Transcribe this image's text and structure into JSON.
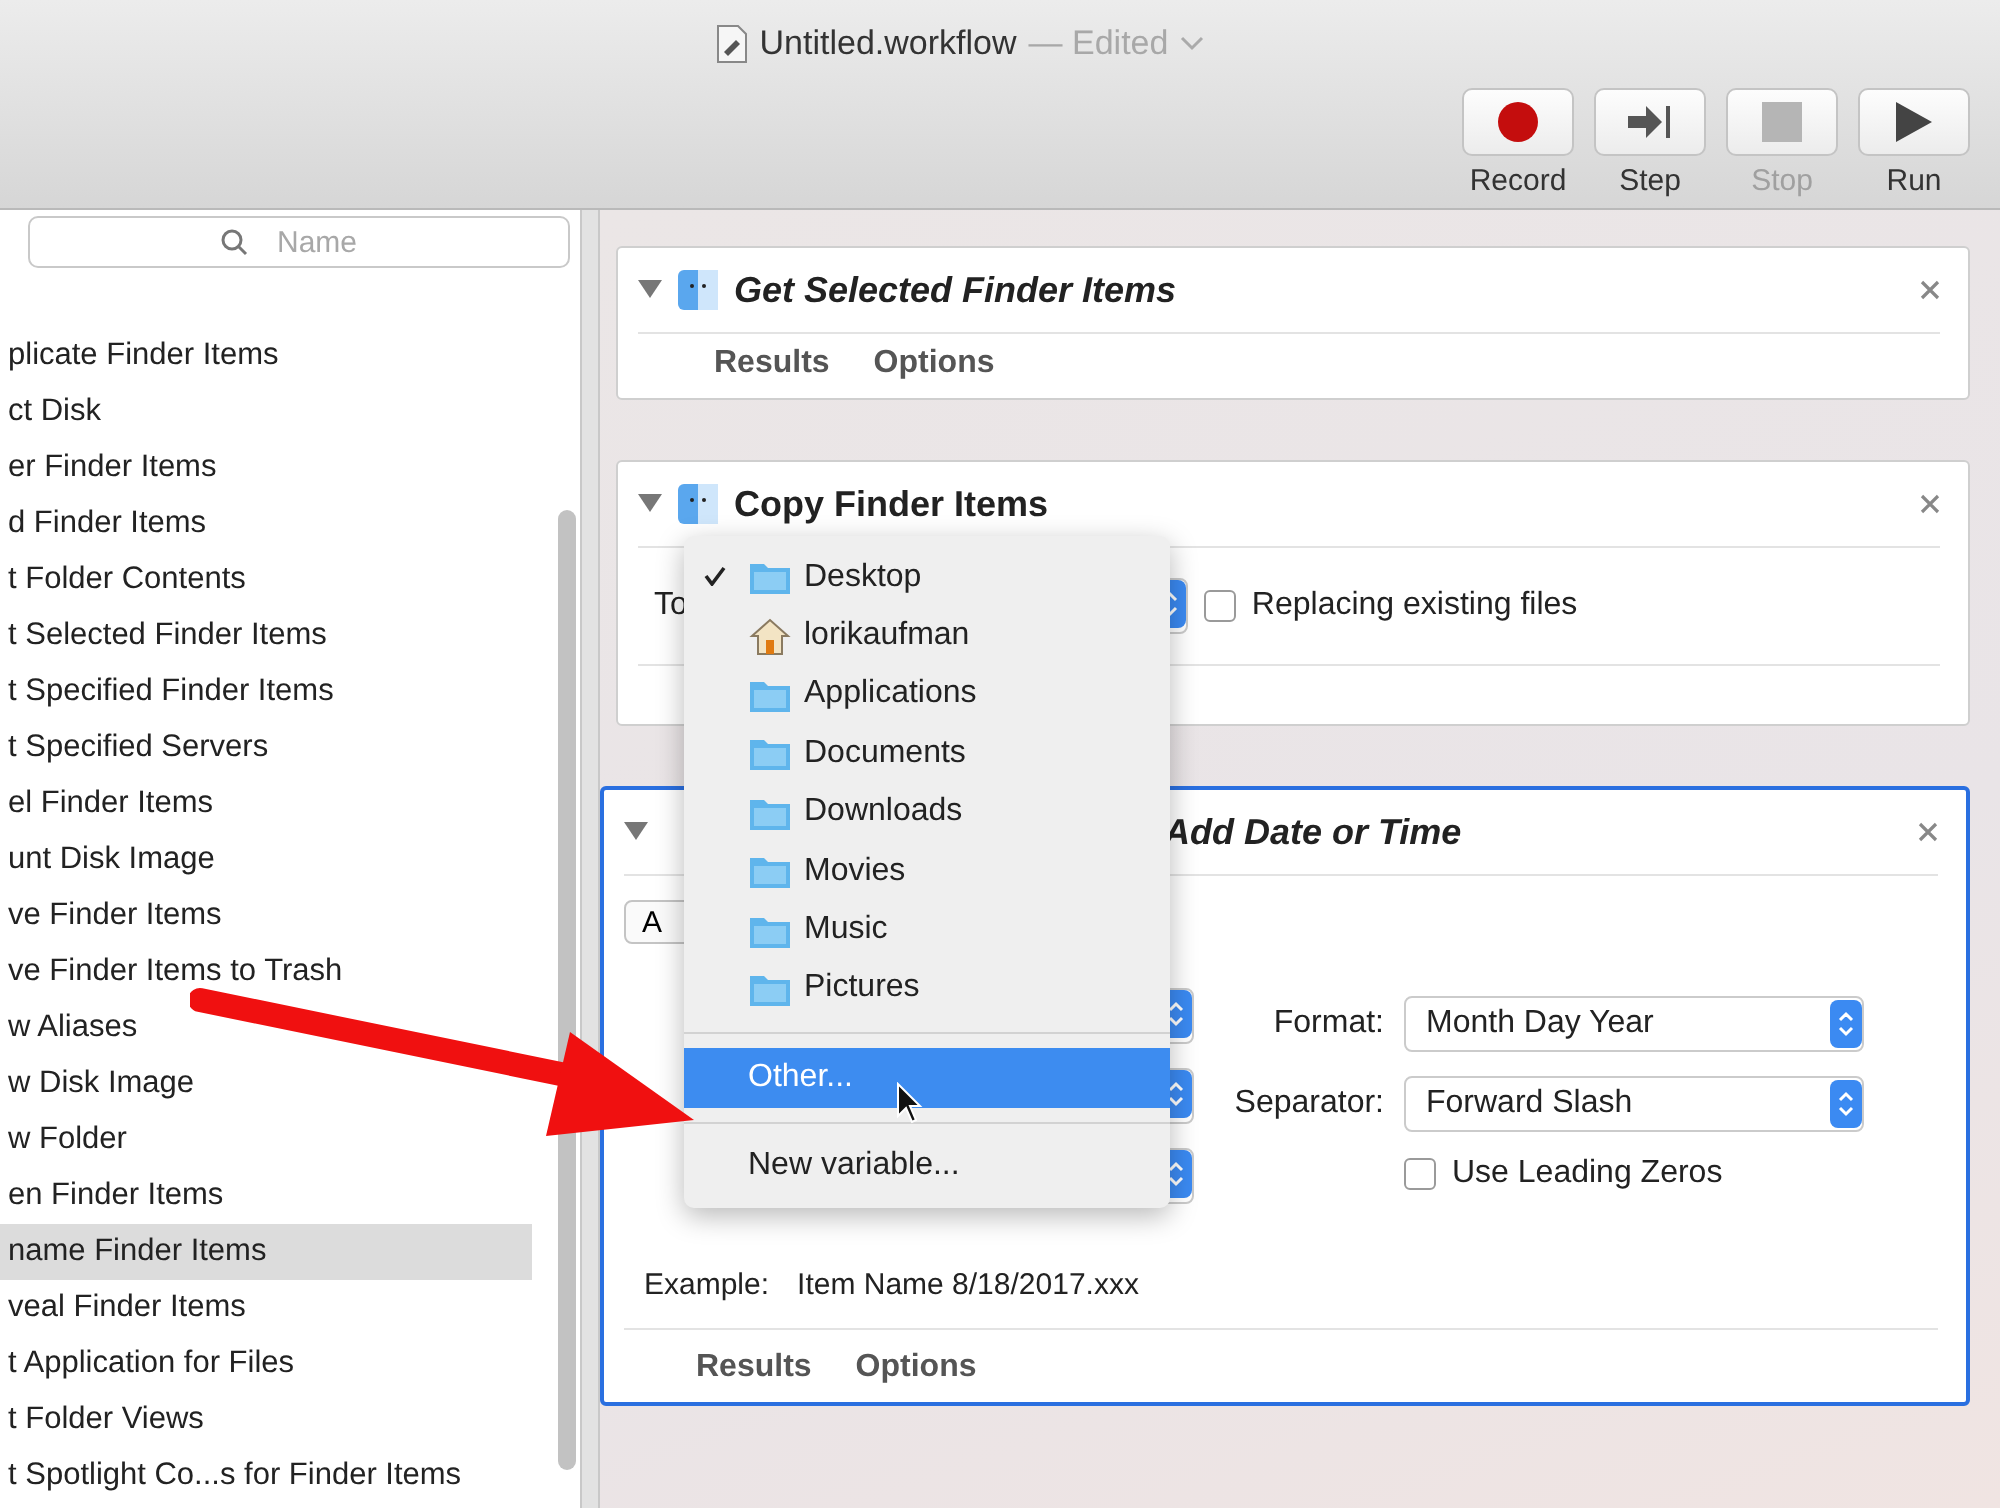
{
  "window": {
    "title": "Untitled.workflow",
    "status": "— Edited"
  },
  "toolbar": [
    {
      "label": "Record",
      "kind": "record",
      "disabled": false
    },
    {
      "label": "Step",
      "kind": "step",
      "disabled": false
    },
    {
      "label": "Stop",
      "kind": "stop",
      "disabled": true
    },
    {
      "label": "Run",
      "kind": "run",
      "disabled": false
    }
  ],
  "library": {
    "search": {
      "placeholder": "Name"
    },
    "items": [
      {
        "label": "plicate Finder Items",
        "selected": false
      },
      {
        "label": "ct Disk",
        "selected": false
      },
      {
        "label": "er Finder Items",
        "selected": false
      },
      {
        "label": "d Finder Items",
        "selected": false
      },
      {
        "label": "t Folder Contents",
        "selected": false
      },
      {
        "label": "t Selected Finder Items",
        "selected": false
      },
      {
        "label": "t Specified Finder Items",
        "selected": false
      },
      {
        "label": "t Specified Servers",
        "selected": false
      },
      {
        "label": "el Finder Items",
        "selected": false
      },
      {
        "label": "unt Disk Image",
        "selected": false
      },
      {
        "label": "ve Finder Items",
        "selected": false
      },
      {
        "label": "ve Finder Items to Trash",
        "selected": false
      },
      {
        "label": "w Aliases",
        "selected": false
      },
      {
        "label": "w Disk Image",
        "selected": false
      },
      {
        "label": "w Folder",
        "selected": false
      },
      {
        "label": "en Finder Items",
        "selected": false
      },
      {
        "label": "name Finder Items",
        "selected": true
      },
      {
        "label": "veal Finder Items",
        "selected": false
      },
      {
        "label": "t Application for Files",
        "selected": false
      },
      {
        "label": "t Folder Views",
        "selected": false
      },
      {
        "label": "t Spotlight Co...s for Finder Items",
        "selected": false
      }
    ]
  },
  "actions": [
    {
      "kind": "basic",
      "title": "Get Selected Finder Items",
      "italic": true,
      "selected": false,
      "tabs": [
        "Results",
        "Options"
      ]
    },
    {
      "kind": "copy",
      "title": "Copy Finder Items",
      "italic": false,
      "selected": false,
      "to_label": "To",
      "replace": {
        "label": "Replacing existing files",
        "checked": false
      }
    },
    {
      "kind": "date",
      "title": "Add Date or Time",
      "italic": true,
      "selected": true,
      "button": "A",
      "format": {
        "label": "Format:",
        "value": "Month Day Year"
      },
      "separator": {
        "label": "Separator:",
        "value": "Forward Slash"
      },
      "leading_zeros": {
        "label": "Use Leading Zeros",
        "checked": false
      },
      "example": {
        "label": "Example:",
        "value": "Item Name 8/18/2017.xxx"
      },
      "tabs": [
        "Results",
        "Options"
      ]
    }
  ],
  "popup_menu": {
    "items": [
      {
        "kind": "folder",
        "label": "Desktop",
        "checked": true,
        "highlighted": false
      },
      {
        "kind": "home",
        "label": "lorikaufman",
        "checked": false,
        "highlighted": false
      },
      {
        "kind": "folder",
        "label": "Applications",
        "checked": false,
        "highlighted": false
      },
      {
        "kind": "folder",
        "label": "Documents",
        "checked": false,
        "highlighted": false
      },
      {
        "kind": "folder",
        "label": "Downloads",
        "checked": false,
        "highlighted": false
      },
      {
        "kind": "folder",
        "label": "Movies",
        "checked": false,
        "highlighted": false
      },
      {
        "kind": "folder",
        "label": "Music",
        "checked": false,
        "highlighted": false
      },
      {
        "kind": "folder",
        "label": "Pictures",
        "checked": false,
        "highlighted": false
      },
      {
        "kind": "separator"
      },
      {
        "kind": "command",
        "label": "Other...",
        "checked": false,
        "highlighted": true
      },
      {
        "kind": "separator"
      },
      {
        "kind": "command",
        "label": "New variable...",
        "checked": false,
        "highlighted": false
      }
    ]
  }
}
